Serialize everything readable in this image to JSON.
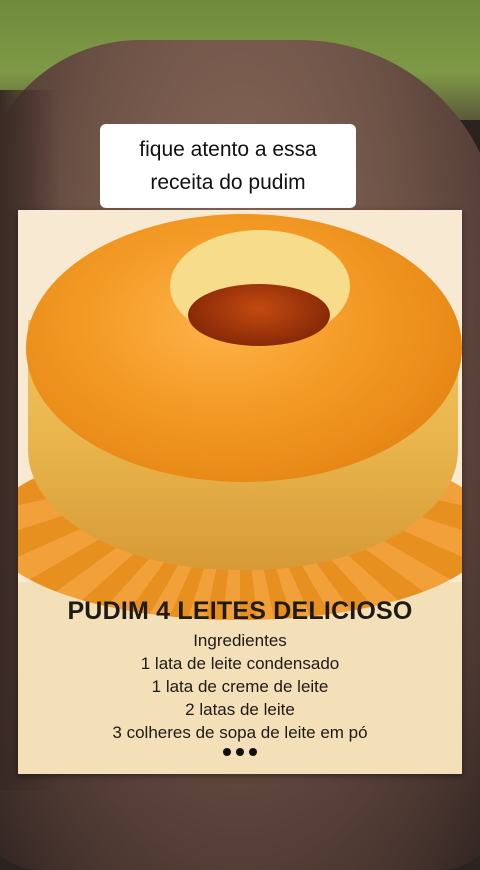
{
  "caption": {
    "text": "fique atento a essa\nreceita do pudim"
  },
  "recipe": {
    "title": "PUDIM 4 LEITES DELICIOSO",
    "subtitle": "Ingredientes",
    "items": [
      "1 lata de leite condensado",
      "1 lata de creme de leite",
      "2 latas de leite",
      "3 colheres de sopa de leite em pó"
    ],
    "more_icon": "ellipsis-icon"
  }
}
